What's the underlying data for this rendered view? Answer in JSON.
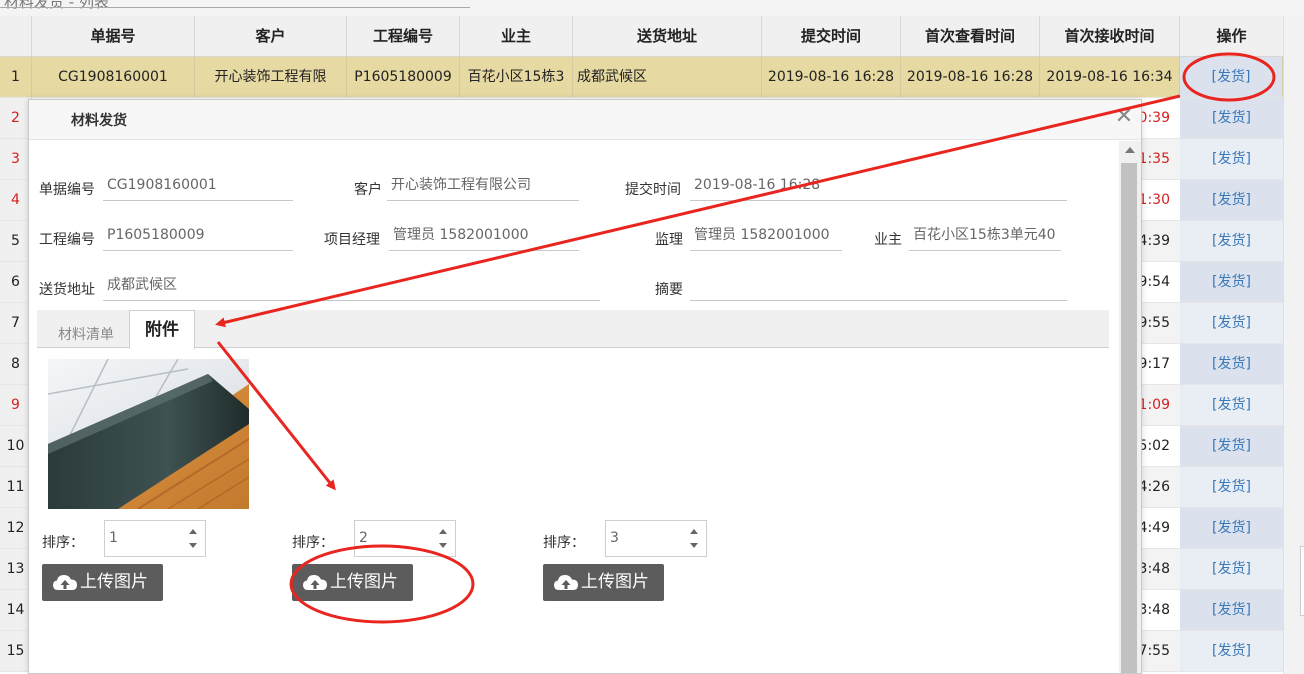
{
  "window": {
    "title_partial": "材料发货 - 列表"
  },
  "grid": {
    "columns": [
      "单据号",
      "客户",
      "工程编号",
      "业主",
      "送货地址",
      "提交时间",
      "首次查看时间",
      "首次接收时间",
      "操作"
    ],
    "selected_row": {
      "num": "1",
      "doc_no": "CG1908160001",
      "customer": "开心装饰工程有限",
      "project_no": "P1605180009",
      "owner": "百花小区15栋3",
      "address": "成都武候区",
      "submit_time": "2019-08-16 16:28",
      "first_view": "2019-08-16 16:28",
      "first_receive": "2019-08-16 16:34",
      "action": "[发货]"
    },
    "rows": [
      {
        "num": "2",
        "tail": "0:39",
        "red": true,
        "action": "[发货]"
      },
      {
        "num": "3",
        "tail": "1:35",
        "red": true,
        "action": "[发货]"
      },
      {
        "num": "4",
        "tail": "1:30",
        "red": true,
        "action": "[发货]"
      },
      {
        "num": "5",
        "tail": "4:39",
        "red": false,
        "action": "[发货]"
      },
      {
        "num": "6",
        "tail": "9:54",
        "red": false,
        "action": "[发货]"
      },
      {
        "num": "7",
        "tail": "9:55",
        "red": false,
        "action": "[发货]"
      },
      {
        "num": "8",
        "tail": "9:17",
        "red": false,
        "action": "[发货]"
      },
      {
        "num": "9",
        "tail": "1:09",
        "red": true,
        "action": "[发货]"
      },
      {
        "num": "10",
        "tail": "5:02",
        "red": false,
        "action": "[发货]"
      },
      {
        "num": "11",
        "tail": "4:26",
        "red": false,
        "action": "[发货]"
      },
      {
        "num": "12",
        "tail": "4:49",
        "red": false,
        "action": "[发货]"
      },
      {
        "num": "13",
        "tail": "3:48",
        "red": false,
        "action": "[发货]"
      },
      {
        "num": "14",
        "tail": "3:48",
        "red": false,
        "action": "[发货]"
      },
      {
        "num": "15",
        "tail": "7:55",
        "red": false,
        "action": "[发货]"
      }
    ]
  },
  "modal": {
    "title": "材料发货",
    "close_icon": "close-icon",
    "labels": {
      "doc_no": "单据编号",
      "customer": "客户",
      "submit_time": "提交时间",
      "project_no": "工程编号",
      "manager": "项目经理",
      "supervisor": "监理",
      "owner": "业主",
      "address": "送货地址",
      "summary": "摘要"
    },
    "values": {
      "doc_no": "CG1908160001",
      "customer": "开心装饰工程有限公司",
      "submit_time": "2019-08-16 16:28",
      "project_no": "P1605180009",
      "manager": "管理员 1582001000",
      "supervisor": "管理员 1582001000",
      "owner": "百花小区15栋3单元40",
      "address": "成都武候区",
      "summary": ""
    },
    "tabs": [
      "材料清单",
      "附件"
    ],
    "active_tab": "附件",
    "attachments": {
      "sort_label": "排序：",
      "upload_label": "上传图片",
      "orders": [
        "1",
        "2",
        "3"
      ]
    }
  },
  "colors": {
    "selected_row": "#e6d9a2",
    "link": "#3a78b8",
    "red_text": "#d62020",
    "upload_button": "#5c5c5c",
    "annotation": "#e8251f"
  }
}
